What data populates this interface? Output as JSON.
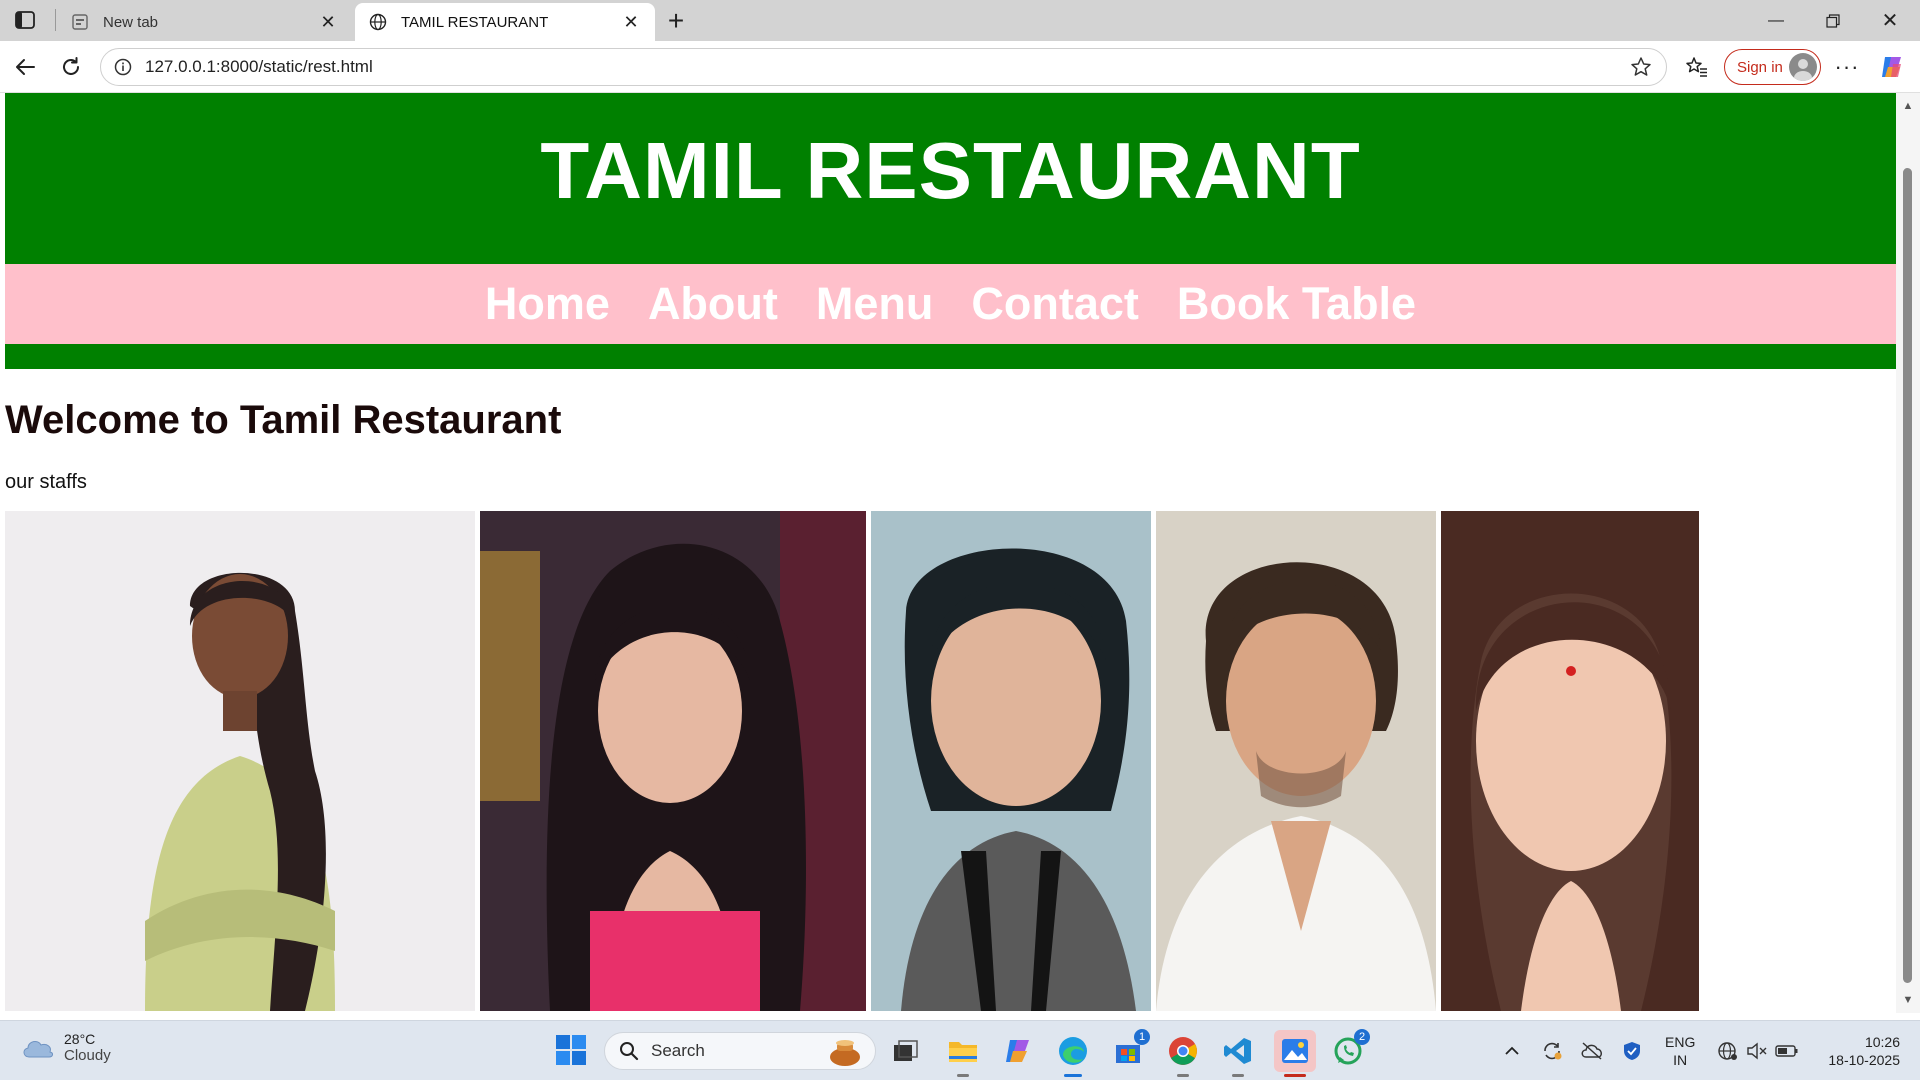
{
  "browser": {
    "tabs": [
      {
        "title": "New tab",
        "active": false
      },
      {
        "title": "TAMIL RESTAURANT",
        "active": true
      }
    ],
    "url": "127.0.0.1:8000/static/rest.html",
    "signin_label": "Sign in"
  },
  "page": {
    "header_title": "TAMIL RESTAURANT",
    "nav": [
      "Home",
      "About",
      "Menu",
      "Contact",
      "Book Table"
    ],
    "welcome_heading": "Welcome to Tamil Restaurant",
    "staff_text": "our staffs",
    "staff_photos": [
      "staff-photo-1",
      "staff-photo-2",
      "staff-photo-3",
      "staff-photo-4",
      "staff-photo-5"
    ],
    "colors": {
      "header_bg": "#008000",
      "nav_bg": "#ffc0cb",
      "nav_text": "#ffffff"
    }
  },
  "taskbar": {
    "weather": {
      "temp": "28°C",
      "condition": "Cloudy"
    },
    "search_placeholder": "Search",
    "badges": {
      "store": "1",
      "whatsapp": "2"
    },
    "lang_line1": "ENG",
    "lang_line2": "IN",
    "time": "10:26",
    "date": "18-10-2025"
  }
}
